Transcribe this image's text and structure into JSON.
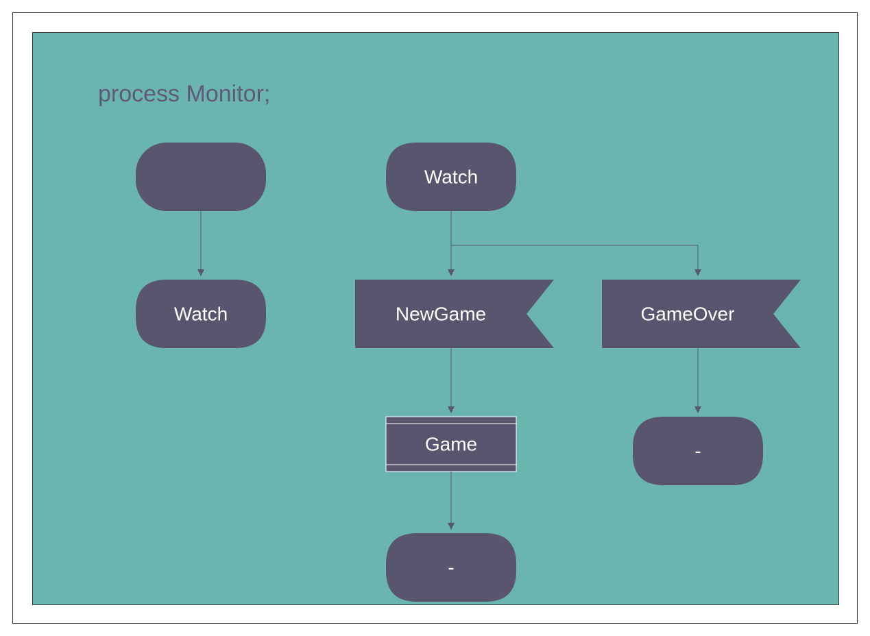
{
  "title_keyword": "process",
  "title_name": "Monitor;",
  "nodes": {
    "start": "",
    "watch_left": "Watch",
    "watch_top": "Watch",
    "newgame": "NewGame",
    "gameover": "GameOver",
    "game": "Game",
    "end_left": "-",
    "end_right": "-"
  },
  "colors": {
    "bg": "#6bb5b0",
    "shape": "#5a556e",
    "text": "#ffffff",
    "title": "#5f5a78"
  }
}
